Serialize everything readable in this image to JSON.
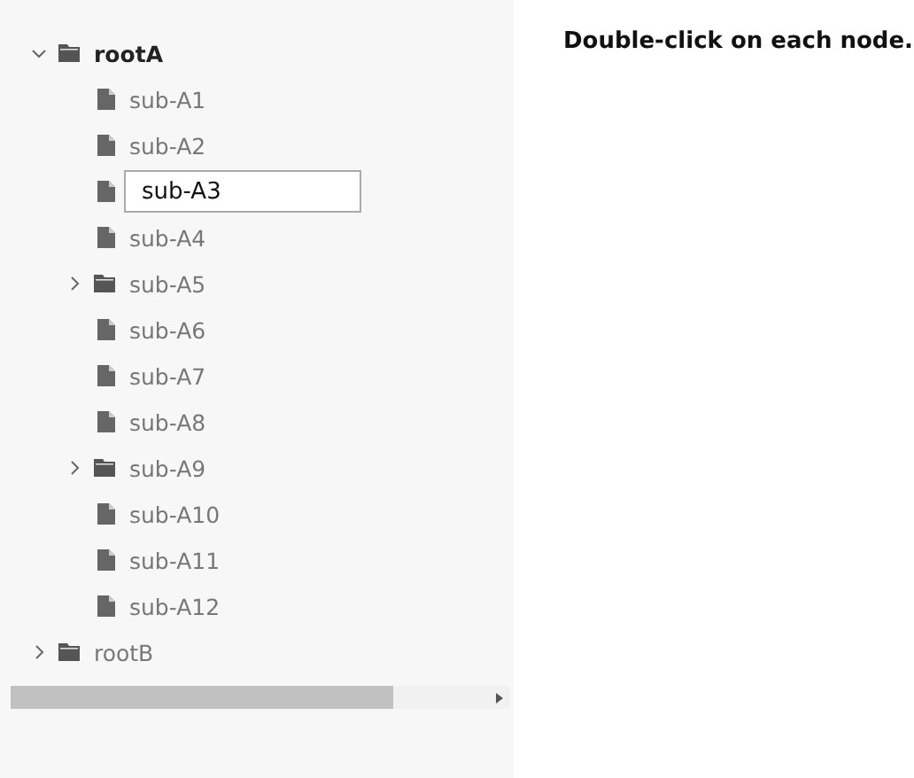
{
  "tree": [
    {
      "label": "rootA",
      "kind": "folder",
      "expanded": true,
      "selected": true,
      "editing": false,
      "children": [
        {
          "label": "sub-A1",
          "kind": "file",
          "selected": false,
          "editing": false
        },
        {
          "label": "sub-A2",
          "kind": "file",
          "selected": false,
          "editing": false
        },
        {
          "label": "sub-A3",
          "kind": "file",
          "selected": false,
          "editing": true
        },
        {
          "label": "sub-A4",
          "kind": "file",
          "selected": false,
          "editing": false
        },
        {
          "label": "sub-A5",
          "kind": "folder",
          "expanded": false,
          "selected": false,
          "editing": false
        },
        {
          "label": "sub-A6",
          "kind": "file",
          "selected": false,
          "editing": false
        },
        {
          "label": "sub-A7",
          "kind": "file",
          "selected": false,
          "editing": false
        },
        {
          "label": "sub-A8",
          "kind": "file",
          "selected": false,
          "editing": false
        },
        {
          "label": "sub-A9",
          "kind": "folder",
          "expanded": false,
          "selected": false,
          "editing": false
        },
        {
          "label": "sub-A10",
          "kind": "file",
          "selected": false,
          "editing": false
        },
        {
          "label": "sub-A11",
          "kind": "file",
          "selected": false,
          "editing": false
        },
        {
          "label": "sub-A12",
          "kind": "file",
          "selected": false,
          "editing": false
        }
      ]
    },
    {
      "label": "rootB",
      "kind": "folder",
      "expanded": false,
      "selected": false,
      "editing": false
    }
  ],
  "instruction": "Double-click on each node."
}
